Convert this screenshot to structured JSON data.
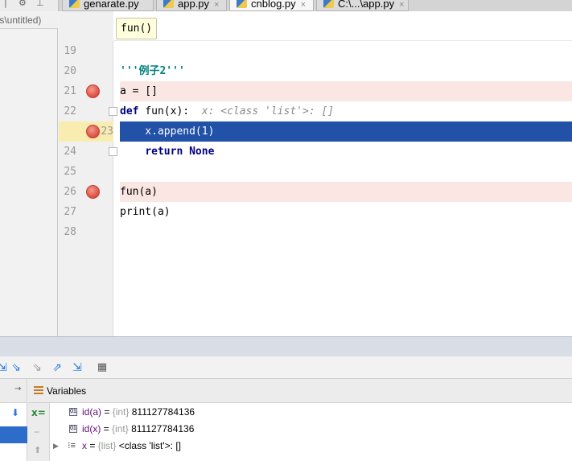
{
  "tabs": [
    {
      "label": "genarate.py",
      "close": ""
    },
    {
      "label": "app.py",
      "close": "×"
    },
    {
      "label": "cnblog.py",
      "close": "×"
    },
    {
      "label": "C:\\...\\app.py",
      "close": "×"
    }
  ],
  "project": {
    "path_fragment": "ts\\untitled)"
  },
  "breadcrumb": {
    "label": "fun()"
  },
  "editor": {
    "lines": [
      {
        "num": "19",
        "code": ""
      },
      {
        "num": "20",
        "code": "'''例子2'''"
      },
      {
        "num": "21",
        "code": "a = []"
      },
      {
        "num": "22",
        "kw": "def",
        "rest": " fun(x):",
        "hint": "  x: <class 'list'>: []"
      },
      {
        "num": "23",
        "code": "    x.append(1)"
      },
      {
        "num": "24",
        "kw": "return",
        "rest2": "None"
      },
      {
        "num": "25",
        "code": ""
      },
      {
        "num": "26",
        "code": "fun(a)"
      },
      {
        "num": "27",
        "code": "print(a)"
      },
      {
        "num": "28",
        "code": ""
      }
    ]
  },
  "debugger": {
    "variables_title": "Variables",
    "vars": [
      {
        "name": "id(a)",
        "type": "{int}",
        "value": "811127784136"
      },
      {
        "name": "id(x)",
        "type": "{int}",
        "value": "811127784136"
      },
      {
        "name": "x",
        "type": "{list}",
        "value": "<class 'list'>: []"
      }
    ],
    "eq": " = "
  },
  "colors": {
    "execution_line": "#2251a8",
    "breakpoint_line": "#fae6e3",
    "breakpoint": "#dd4b3f"
  }
}
